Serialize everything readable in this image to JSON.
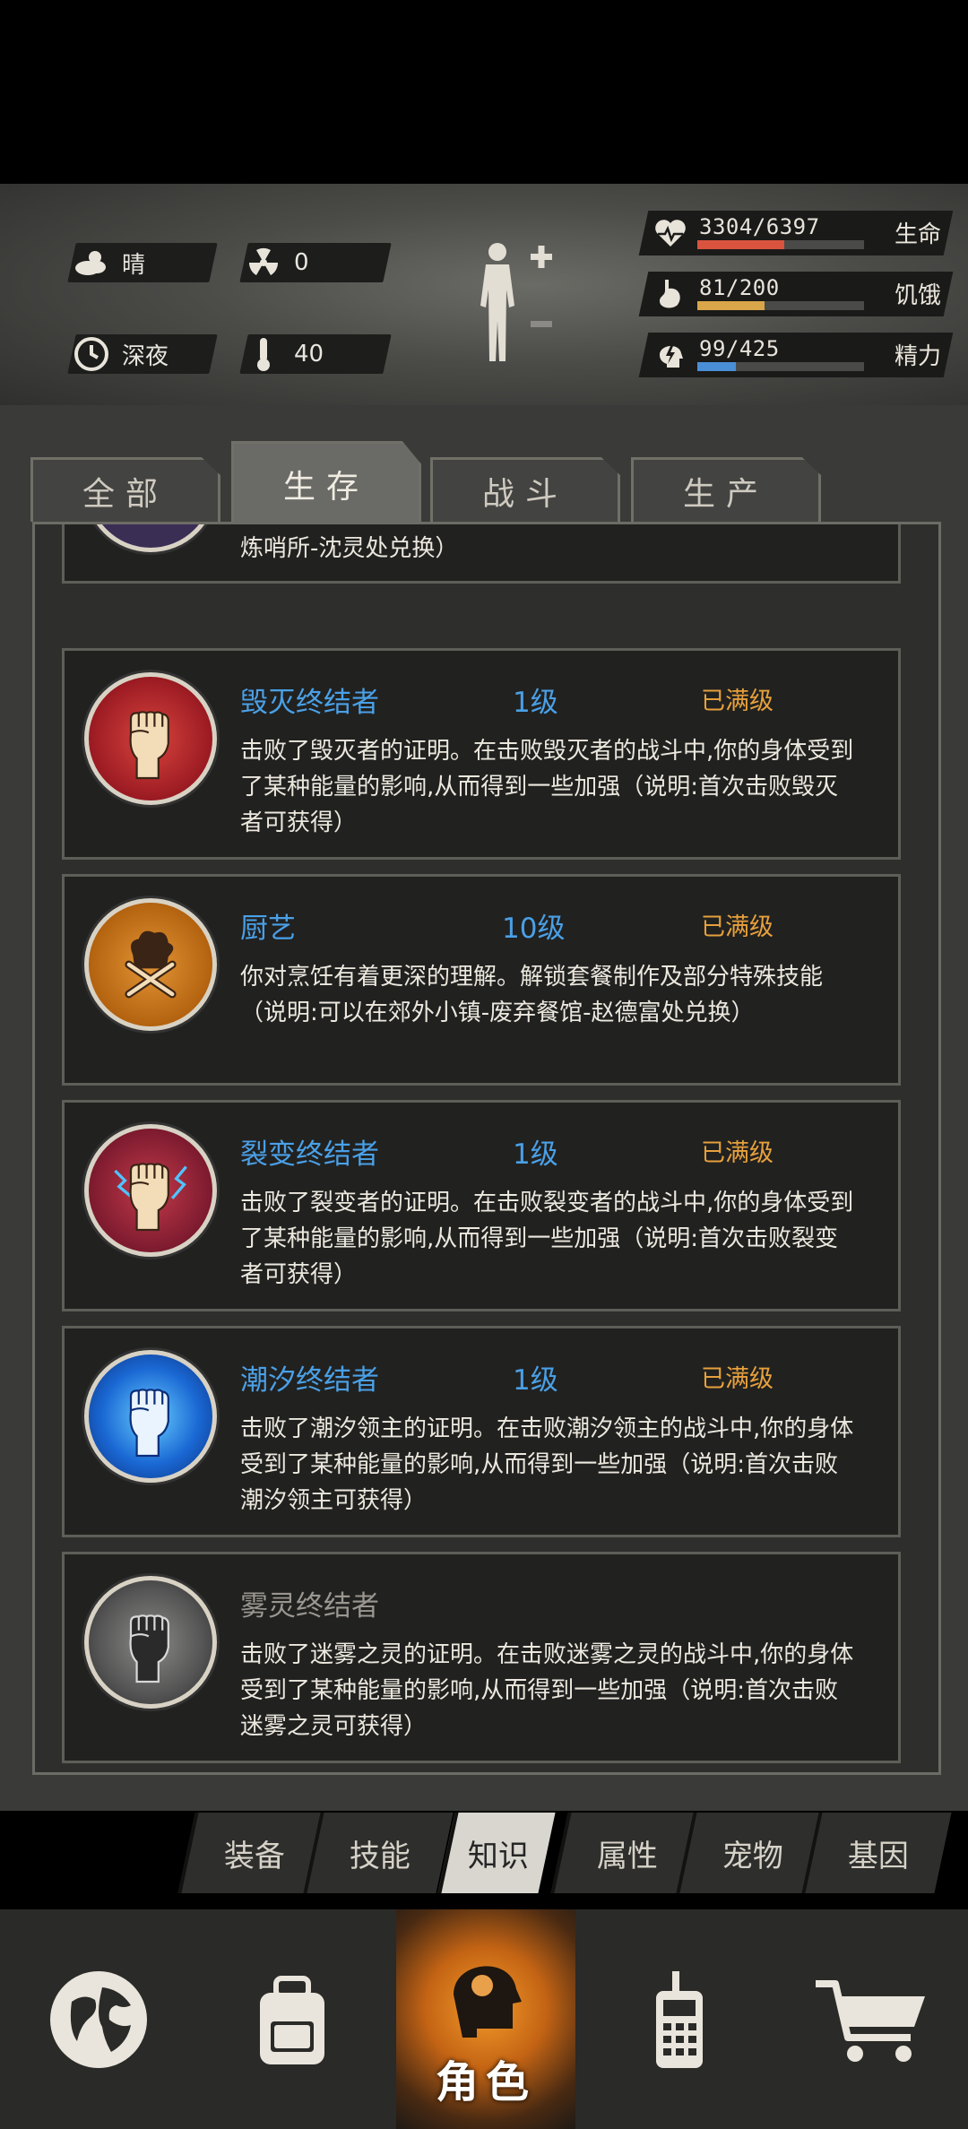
{
  "weather": {
    "condition": "晴",
    "radiation": "0",
    "time_of_day": "深夜",
    "temperature": "40"
  },
  "vitals": [
    {
      "name": "生命",
      "value": "3304/6397",
      "fraction": 0.52,
      "color": "#d9533f",
      "icon": "heart-pulse-icon"
    },
    {
      "name": "饥饿",
      "value": "81/200",
      "fraction": 0.405,
      "color": "#d9a64a",
      "icon": "stomach-icon"
    },
    {
      "name": "精力",
      "value": "99/425",
      "fraction": 0.233,
      "color": "#4a8fd6",
      "icon": "head-lightning-icon"
    }
  ],
  "tabs": [
    {
      "label": "全部",
      "active": false
    },
    {
      "label": "生存",
      "active": true
    },
    {
      "label": "战斗",
      "active": false
    },
    {
      "label": "生产",
      "active": false
    }
  ],
  "partial_card": {
    "desc": "炼哨所-沈灵处兑换）"
  },
  "cards": [
    {
      "title": "毁灭终结者",
      "level": "1级",
      "status": "已满级",
      "desc": "击败了毁灭者的证明。在击败毁灭者的战斗中,你的身体受到了某种能量的影响,从而得到一些加强（说明:首次击败毁灭者可获得）",
      "icon": "red-fist-icon",
      "badge_color": "#b8222a"
    },
    {
      "title": "厨艺",
      "level": "10级",
      "status": "已满级",
      "desc": "你对烹饪有着更深的理解。解锁套餐制作及部分特殊技能（说明:可以在郊外小镇-废弃餐馆-赵德富处兑换）",
      "icon": "chef-hat-utensils-icon",
      "badge_color": "#b8650f"
    },
    {
      "title": "裂变终结者",
      "level": "1级",
      "status": "已满级",
      "desc": "击败了裂变者的证明。在击败裂变者的战斗中,你的身体受到了某种能量的影响,从而得到一些加强（说明:首次击败裂变者可获得）",
      "icon": "lightning-fist-icon",
      "badge_color": "#8a2336"
    },
    {
      "title": "潮汐终结者",
      "level": "1级",
      "status": "已满级",
      "desc": "击败了潮汐领主的证明。在击败潮汐领主的战斗中,你的身体受到了某种能量的影响,从而得到一些加强（说明:首次击败潮汐领主可获得）",
      "icon": "blue-fist-icon",
      "badge_color": "#1a5fc8"
    },
    {
      "title": "雾灵终结者",
      "level": "",
      "status": "",
      "desc": "击败了迷雾之灵的证明。在击败迷雾之灵的战斗中,你的身体受到了某种能量的影响,从而得到一些加强（说明:首次击败迷雾之灵可获得）",
      "icon": "gray-fist-icon",
      "badge_color": "#6b6b6b"
    }
  ],
  "subtabs": [
    {
      "label": "装备",
      "active": false
    },
    {
      "label": "技能",
      "active": false
    },
    {
      "label": "知识",
      "active": true
    },
    {
      "label": "属性",
      "active": false
    },
    {
      "label": "宠物",
      "active": false
    },
    {
      "label": "基因",
      "active": false
    }
  ],
  "bottom_nav": [
    {
      "icon": "globe-icon",
      "label": "",
      "active": false
    },
    {
      "icon": "backpack-icon",
      "label": "",
      "active": false
    },
    {
      "icon": "character-head-icon",
      "label": "角色",
      "active": true
    },
    {
      "icon": "walkie-talkie-icon",
      "label": "",
      "active": false
    },
    {
      "icon": "shopping-cart-icon",
      "label": "",
      "active": false
    }
  ]
}
